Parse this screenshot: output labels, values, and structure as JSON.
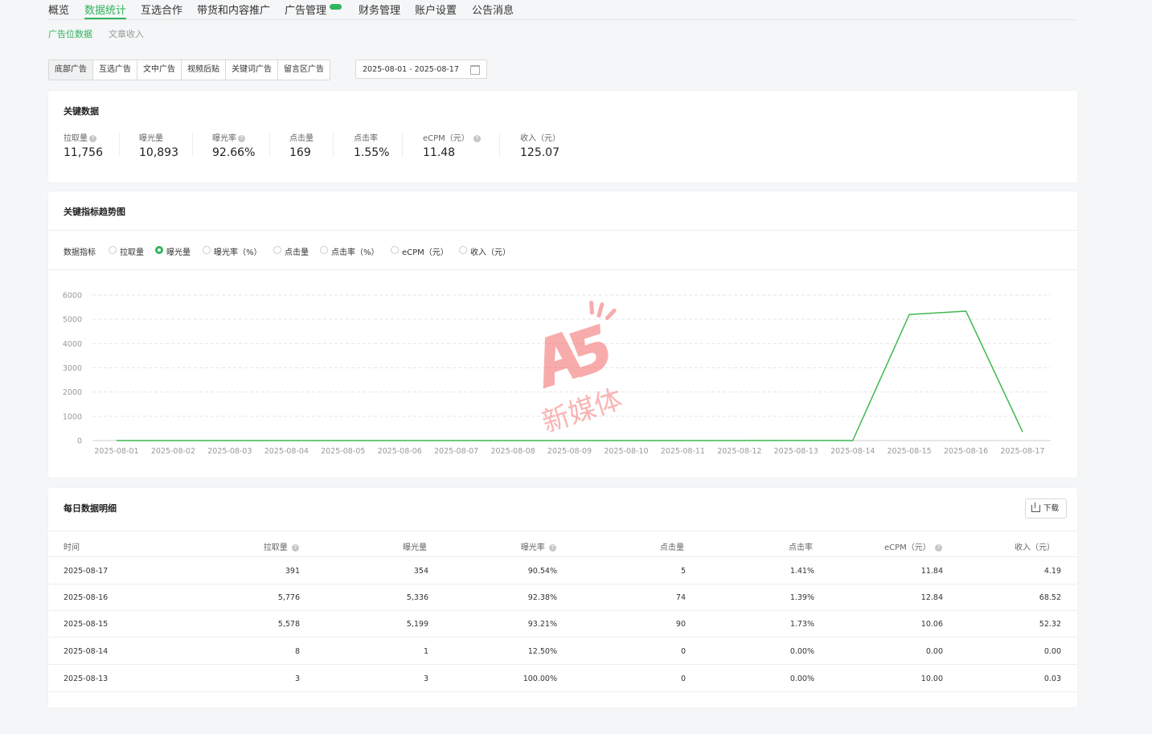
{
  "nav": {
    "tabs": [
      "概览",
      "数据统计",
      "互选合作",
      "带货和内容推广",
      "广告管理",
      "财务管理",
      "账户设置",
      "公告消息"
    ],
    "active": "数据统计"
  },
  "subnav": {
    "items": [
      "广告位数据",
      "文章收入"
    ],
    "active": "广告位数据"
  },
  "ad_types": [
    "底部广告",
    "互选广告",
    "文中广告",
    "视频后贴",
    "关键词广告",
    "留言区广告"
  ],
  "date_range": "2025-08-01 - 2025-08-17",
  "key_data": {
    "title": "关键数据",
    "metrics": [
      {
        "label": "拉取量",
        "value": "11,756",
        "help": true
      },
      {
        "label": "曝光量",
        "value": "10,893",
        "help": false
      },
      {
        "label": "曝光率",
        "value": "92.66%",
        "help": true
      },
      {
        "label": "点击量",
        "value": "169",
        "help": false
      },
      {
        "label": "点击率",
        "value": "1.55%",
        "help": false
      },
      {
        "label": "eCPM（元）",
        "value": "11.48",
        "help": true
      },
      {
        "label": "收入（元）",
        "value": "125.07",
        "help": false
      }
    ]
  },
  "trend": {
    "title": "关键指标趋势图",
    "indicator_label": "数据指标",
    "options": [
      "拉取量",
      "曝光量",
      "曝光率（%）",
      "点击量",
      "点击率（%）",
      "eCPM（元）",
      "收入（元）"
    ],
    "selected": "曝光量"
  },
  "chart_data": {
    "type": "line",
    "x": [
      "2025-08-01",
      "2025-08-02",
      "2025-08-03",
      "2025-08-04",
      "2025-08-05",
      "2025-08-06",
      "2025-08-07",
      "2025-08-08",
      "2025-08-09",
      "2025-08-10",
      "2025-08-11",
      "2025-08-12",
      "2025-08-13",
      "2025-08-14",
      "2025-08-15",
      "2025-08-16",
      "2025-08-17"
    ],
    "series": [
      {
        "values": [
          0,
          0,
          0,
          0,
          0,
          0,
          0,
          0,
          0,
          0,
          0,
          0,
          3,
          1,
          5199,
          5336,
          354
        ]
      }
    ],
    "ylim": [
      0,
      6000
    ],
    "yticks": [
      0,
      1000,
      2000,
      3000,
      4000,
      5000,
      6000
    ],
    "grid": true,
    "color": "#3db84f"
  },
  "watermark": "新媒体",
  "daily": {
    "title": "每日数据明细",
    "download_label": "下载",
    "columns": [
      "时间",
      "拉取量",
      "曝光量",
      "曝光率",
      "点击量",
      "点击率",
      "eCPM（元）",
      "收入（元）"
    ],
    "rows": [
      [
        "2025-08-17",
        "391",
        "354",
        "90.54%",
        "5",
        "1.41%",
        "11.84",
        "4.19"
      ],
      [
        "2025-08-16",
        "5,776",
        "5,336",
        "92.38%",
        "74",
        "1.39%",
        "12.84",
        "68.52"
      ],
      [
        "2025-08-15",
        "5,578",
        "5,199",
        "93.21%",
        "90",
        "1.73%",
        "10.06",
        "52.32"
      ],
      [
        "2025-08-14",
        "8",
        "1",
        "12.50%",
        "0",
        "0.00%",
        "0.00",
        "0.00"
      ],
      [
        "2025-08-13",
        "3",
        "3",
        "100.00%",
        "0",
        "0.00%",
        "10.00",
        "0.03"
      ]
    ]
  }
}
